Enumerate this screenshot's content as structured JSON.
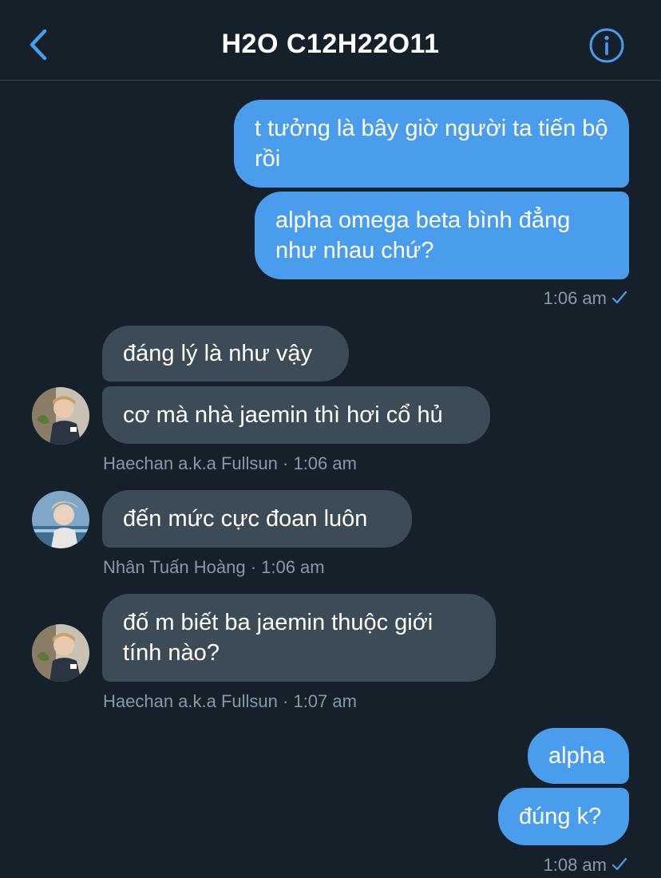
{
  "header": {
    "title": "H2O C12H22O11",
    "back_icon": "chevron-left-icon",
    "info_icon": "info-icon",
    "accent": "#4a9ded"
  },
  "messages": {
    "m1": "t tưởng là bây giờ người ta tiến bộ rồi",
    "m2": "alpha omega beta bình đẳng như nhau chứ?",
    "m2_time": "1:06 am",
    "m3": "đáng lý là như vậy",
    "m4": "cơ mà nhà jaemin thì hơi cổ hủ",
    "m4_meta": "Haechan a.k.a Fullsun · 1:06 am",
    "m5": "đến mức cực đoan luôn",
    "m5_meta": "Nhân Tuấn Hoàng · 1:06 am",
    "m6": "đố m biết ba jaemin thuộc giới tính nào?",
    "m6_meta": "Haechan a.k.a Fullsun · 1:07 am",
    "m7": "alpha",
    "m8": "đúng k?",
    "m8_time": "1:08 am"
  },
  "colors": {
    "background": "#15202b",
    "outgoing": "#4a9ded",
    "incoming": "#3d4b57",
    "meta_text": "#8899a6"
  }
}
